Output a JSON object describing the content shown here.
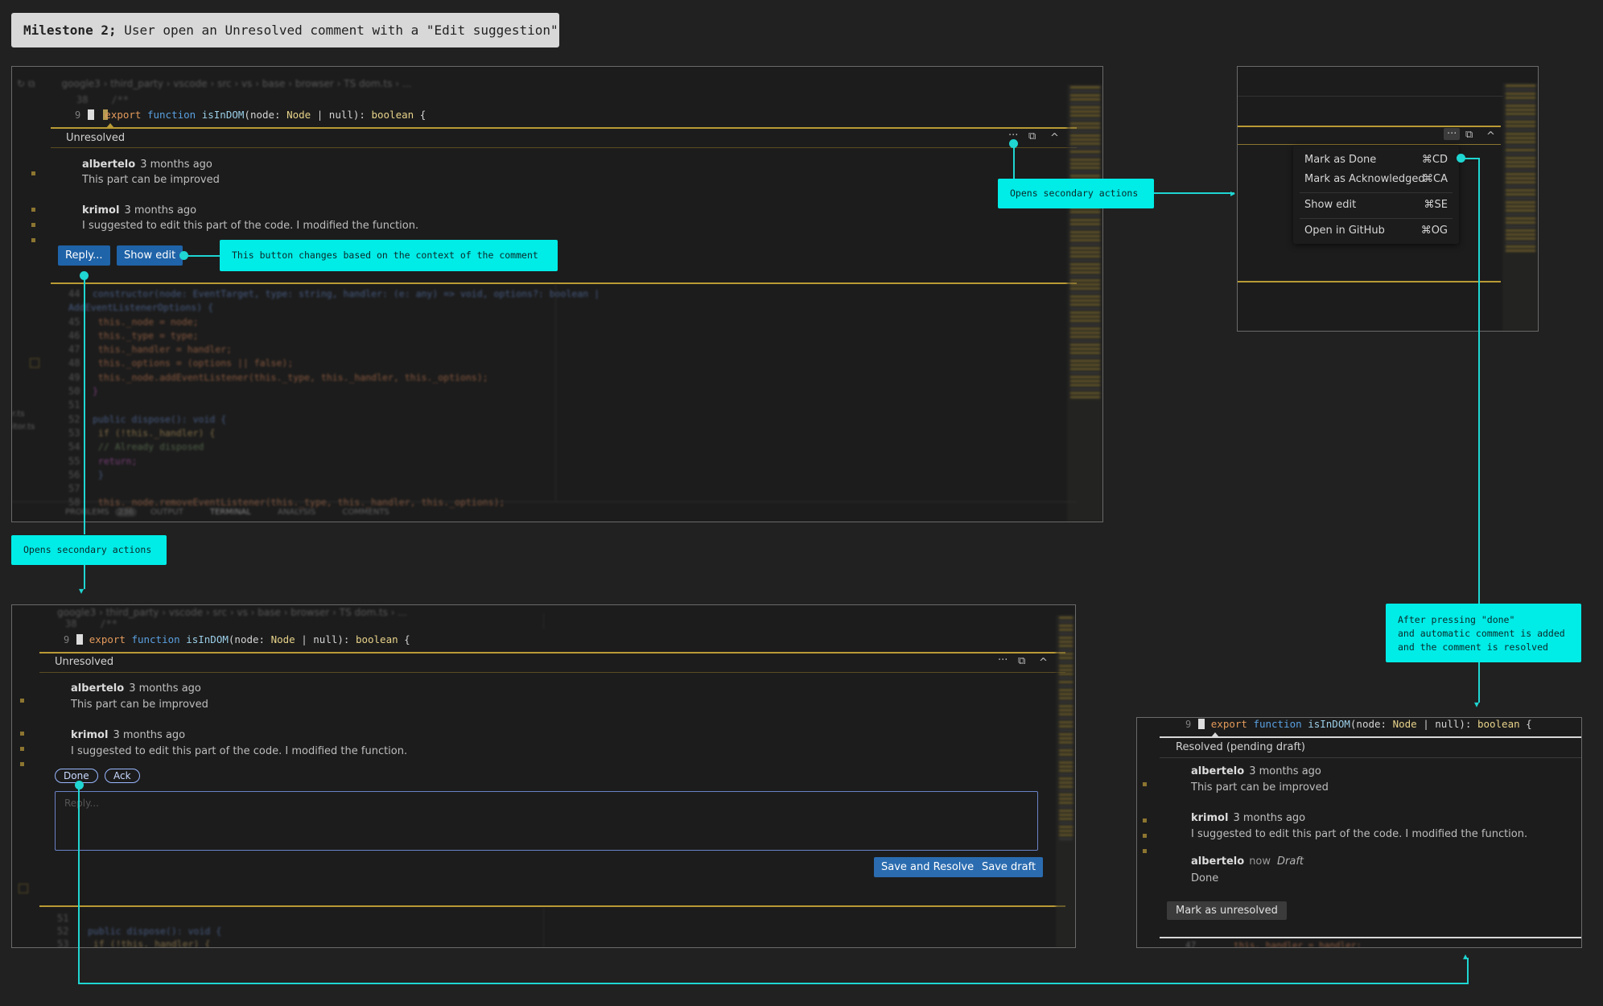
{
  "title": {
    "bold": "Milestone 2;",
    "rest": " User open an Unresolved comment with a \"Edit suggestion\""
  },
  "code": {
    "breadcrumb": "google3 › third_party › vscode › src › vs › base › browser › TS dom.ts › ...",
    "line_num": "9",
    "prev_num": "38",
    "prev_text": "/**",
    "export_kw": "export",
    "function_kw": "function",
    "fn_name": "isInDOM",
    "params_a": "(node: ",
    "type_node": "Node",
    "params_b": " | null): ",
    "type_bool": "boolean",
    "brace": " {",
    "bg_lines": [
      {
        "num": "44",
        "text": "constructor(node: EventTarget, type: string, handler: (e: any) => void, options?: boolean | AddEventListenerOptions) {"
      },
      {
        "num": "45",
        "text": "  this._node = node;"
      },
      {
        "num": "46",
        "text": "  this._type = type;"
      },
      {
        "num": "47",
        "text": "  this._handler = handler;"
      },
      {
        "num": "48",
        "text": "  this._options = (options || false);"
      },
      {
        "num": "49",
        "text": "  this._node.addEventListener(this._type, this._handler, this._options);"
      },
      {
        "num": "50",
        "text": "}"
      },
      {
        "num": "51",
        "text": ""
      },
      {
        "num": "52",
        "text": "public dispose(): void {"
      },
      {
        "num": "53",
        "text": "  if (!this._handler) {"
      },
      {
        "num": "54",
        "text": "    // Already disposed"
      },
      {
        "num": "55",
        "text": "    return;"
      },
      {
        "num": "56",
        "text": "  }"
      },
      {
        "num": "57",
        "text": ""
      },
      {
        "num": "58",
        "text": "  this._node.removeEventListener(this._type, this._handler, this._options);"
      }
    ],
    "panel_tabs": [
      "PROBLEMS",
      "236",
      "OUTPUT",
      "TERMINAL",
      "ANALYSIS",
      "COMMENTS"
    ],
    "side_labels": [
      "r.ts",
      "itor.ts"
    ],
    "bottom_lines": [
      {
        "num": "51",
        "text": ""
      },
      {
        "num": "52",
        "text": "public dispose(): void {"
      },
      {
        "num": "53",
        "text": "  if (!this._handler) {"
      }
    ],
    "resolved_tail": {
      "num": "47",
      "text": "this._handler = handler;"
    }
  },
  "thread": {
    "status_unresolved": "Unresolved",
    "status_resolved": "Resolved (pending draft)",
    "comments": [
      {
        "author": "albertelo",
        "ago": "3 months ago",
        "body": "This part can be improved"
      },
      {
        "author": "krimol",
        "ago": "3 months ago",
        "body": "I suggested to edit this part of the code. I modified the function."
      }
    ],
    "draft_comment": {
      "author": "albertelo",
      "ago": "now",
      "tag": "Draft",
      "body": "Done"
    },
    "reply_button": "Reply...",
    "show_edit_button": "Show edit",
    "done_button": "Done",
    "ack_button": "Ack",
    "reply_placeholder": "Reply...",
    "save_resolve_button": "Save and Resolve",
    "save_draft_button": "Save draft",
    "mark_unresolved_button": "Mark as unresolved",
    "more_icon": "···",
    "expand_icon": "⧉",
    "collapse_icon": "^"
  },
  "menu": {
    "items": [
      {
        "label": "Mark as Done",
        "shortcut": "⌘CD"
      },
      {
        "label": "Mark as Acknowledged",
        "shortcut": "⌘CA"
      },
      {
        "label": "Show edit",
        "shortcut": "⌘SE"
      },
      {
        "label": "Open in GitHub",
        "shortcut": "⌘OG"
      }
    ]
  },
  "annotations": {
    "context_button": "This button changes based on the context of the comment",
    "secondary_top": "Opens secondary actions",
    "secondary_left": "Opens secondary actions",
    "after_done": [
      "After pressing \"done\"",
      "and automatic comment is added",
      "and the comment is resolved"
    ]
  },
  "colors": {
    "accent": "#00ece7",
    "gold": "#b99a35",
    "button_blue": "#1f63a8"
  }
}
